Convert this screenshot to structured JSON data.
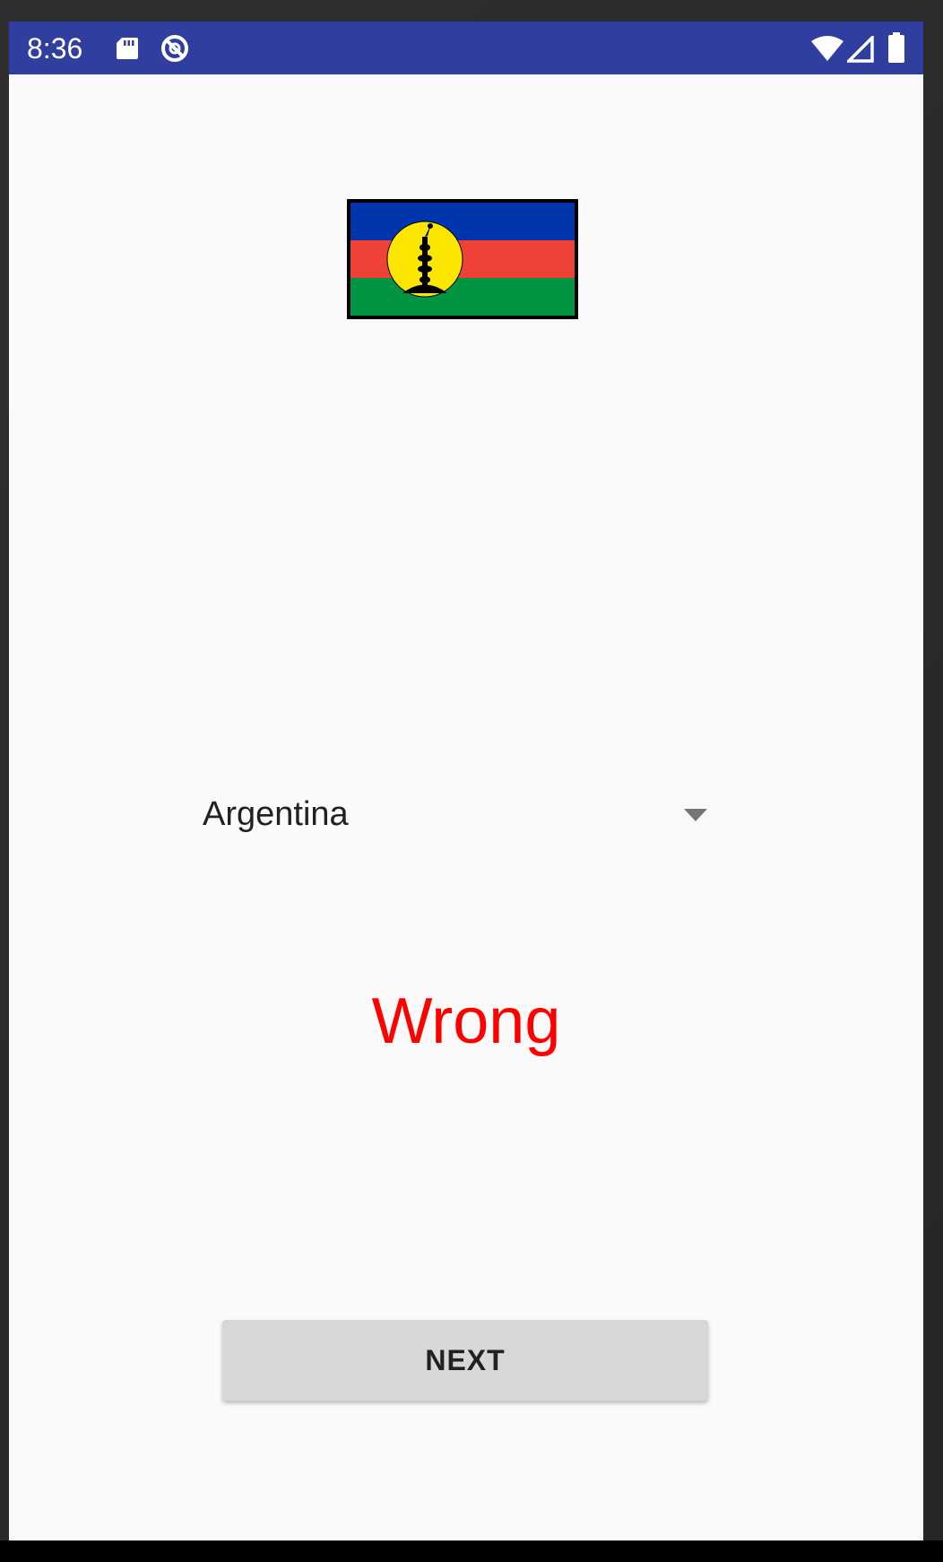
{
  "status_bar": {
    "time": "8:36",
    "background": "#303f9f",
    "icons": [
      "sd-card-icon",
      "do-not-disturb-icon",
      "wifi-icon",
      "cell-signal-icon",
      "battery-icon"
    ]
  },
  "flag": {
    "icon": "new-caledonia-flag-icon",
    "colors": {
      "blue": "#0035ad",
      "red": "#ef4135",
      "green": "#009543",
      "disc": "#fae600"
    }
  },
  "spinner": {
    "selected_value": "Argentina"
  },
  "result": {
    "text": "Wrong",
    "color": "#ff0000"
  },
  "next_button": {
    "label": "NEXT"
  }
}
